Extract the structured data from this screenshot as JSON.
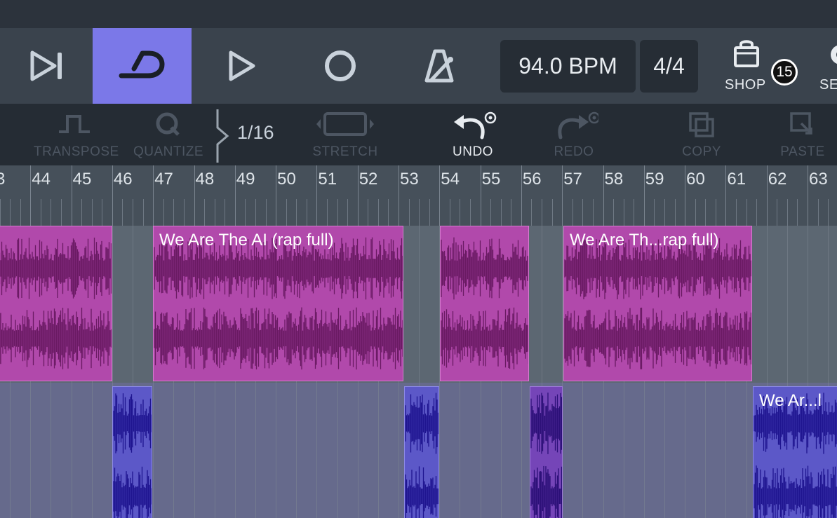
{
  "transport": {
    "tempo": "94.0 BPM",
    "time_signature": "4/4",
    "shop_label": "SHOP",
    "shop_badge": "15",
    "settings_label_partial": "SE",
    "loop_active": true
  },
  "toolbar": {
    "transpose": "TRANSPOSE",
    "quantize": "QUANTIZE",
    "grid_value": "1/16",
    "stretch": "STRETCH",
    "undo": "UNDO",
    "redo": "REDO",
    "copy": "COPY",
    "paste": "PASTE"
  },
  "ruler": {
    "bars": [
      "3",
      "44",
      "45",
      "46",
      "47",
      "48",
      "49",
      "50",
      "51",
      "52",
      "53",
      "54",
      "55",
      "56",
      "57",
      "58",
      "59",
      "60",
      "61",
      "62",
      "63"
    ]
  },
  "tracks": [
    {
      "color": "#b149ab",
      "clips": [
        {
          "title": ""
        },
        {
          "title": "We Are The AI (rap full)"
        },
        {
          "title": ""
        },
        {
          "title": "We Are Th...rap full)"
        }
      ]
    },
    {
      "color": "#5c58c8",
      "clips": [
        {
          "title": ""
        },
        {
          "title": ""
        },
        {
          "title": ""
        },
        {
          "title": "We Ar...l"
        }
      ]
    }
  ]
}
